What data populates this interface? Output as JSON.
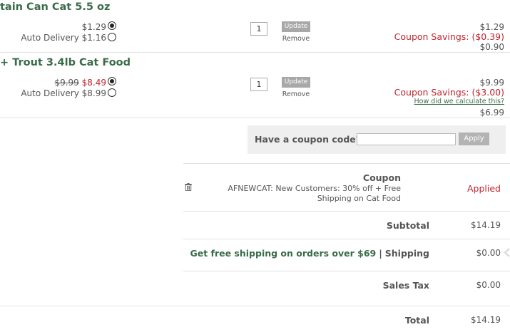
{
  "items": [
    {
      "title": "tain Can Cat 5.5 oz",
      "price_regular": "$1.29",
      "price_autodelivery": "Auto Delivery $1.16",
      "qty": "1",
      "update_label": "Update",
      "remove_label": "Remove",
      "line_total": "$1.29",
      "coupon_savings": "Coupon Savings: ($0.39)",
      "final_total": "$0.90"
    },
    {
      "title": "+ Trout 3.4lb Cat Food",
      "price_original": "$9.99",
      "price_sale": "$8.49",
      "price_autodelivery": "Auto Delivery $8.99",
      "qty": "1",
      "update_label": "Update",
      "remove_label": "Remove",
      "line_total": "$9.99",
      "coupon_savings": "Coupon Savings: ($3.00)",
      "calc_link": "How did we calculate this?",
      "final_total": "$6.99"
    }
  ],
  "coupon_form": {
    "prompt": "Have a coupon code?",
    "input_value": "",
    "apply_label": "Apply"
  },
  "summary": {
    "coupon_heading": "Coupon",
    "coupon_description": "AFNEWCAT: New Customers: 30% off + Free Shipping on Cat Food",
    "coupon_status": "Applied",
    "subtotal_label": "Subtotal",
    "subtotal_value": "$14.19",
    "shipping_promo": "Get free shipping on orders over $69",
    "shipping_separator": "|",
    "shipping_label": "Shipping",
    "shipping_value": "$0.00",
    "tax_label": "Sales Tax",
    "tax_value": "$0.00",
    "total_label": "Total",
    "total_value": "$14.19"
  },
  "colors": {
    "title_green": "#3a6b4a",
    "savings_red": "#c0252f",
    "button_gray": "#a8a8a8"
  }
}
